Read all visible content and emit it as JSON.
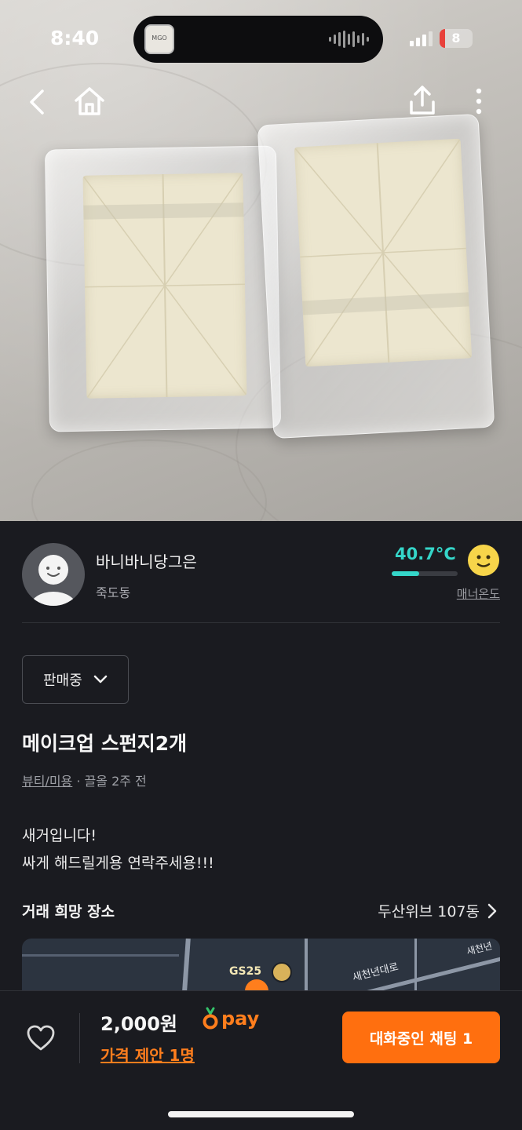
{
  "status_bar": {
    "time": "8:40",
    "battery": "8",
    "island_thumb_text": "MGO"
  },
  "nav": {
    "back_icon": "chevron-left-icon",
    "home_icon": "home-icon",
    "share_icon": "share-icon",
    "more_icon": "more-vertical-icon"
  },
  "seller": {
    "name": "바니바니당그은",
    "location": "죽도동",
    "temperature": "40.7°C",
    "temperature_value": 40.7,
    "manner_label": "매너온도"
  },
  "listing": {
    "status": "판매중",
    "title": "메이크업 스펀지2개",
    "category": "뷰티/미용",
    "meta_suffix": " · 끌올 2주 전",
    "description_lines": [
      "새거입니다!",
      "싸게 해드릴게용 연락주세용!!!"
    ]
  },
  "place": {
    "label": "거래 희망 장소",
    "value": "두산위브 107동"
  },
  "map": {
    "poi": "GS25",
    "street": "새천년대로",
    "street2": "새천년"
  },
  "bottom": {
    "price": "2,000원",
    "pay_label": "pay",
    "offer": "가격 제안 1명",
    "chat_button": "대화중인 채팅 1"
  },
  "colors": {
    "accent": "#ff6f0f",
    "temperature": "#35d6c9",
    "background": "#1a1b20"
  }
}
